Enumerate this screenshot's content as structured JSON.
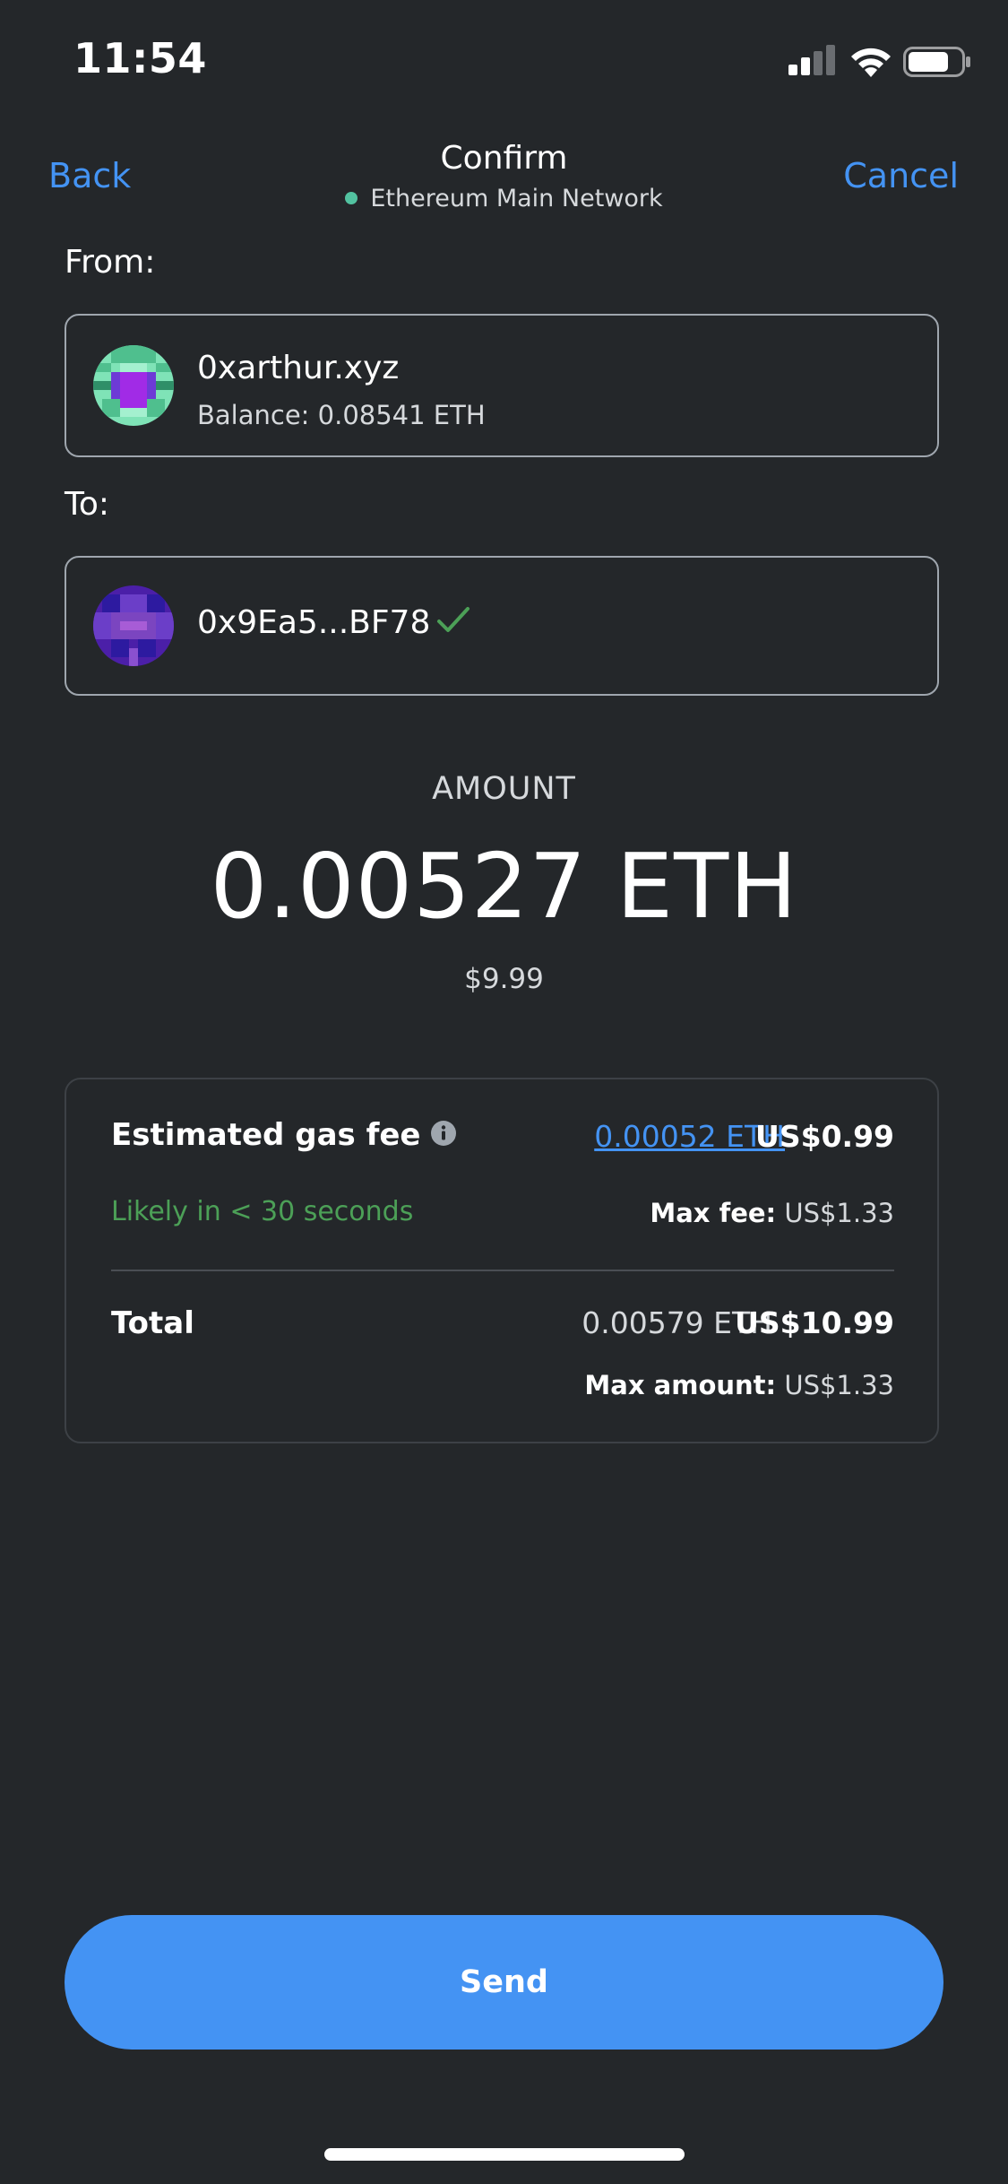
{
  "status_bar": {
    "time": "11:54",
    "icons": [
      "signal-icon",
      "wifi-icon",
      "battery-icon"
    ]
  },
  "header": {
    "back_label": "Back",
    "title": "Confirm",
    "network": "Ethereum Main Network",
    "cancel_label": "Cancel"
  },
  "from": {
    "label": "From:",
    "account_name": "0xarthur.xyz",
    "balance": "Balance: 0.08541 ETH"
  },
  "to": {
    "label": "To:",
    "address": "0x9Ea5...BF78",
    "verified_icon": "check-icon"
  },
  "amount": {
    "label": "AMOUNT",
    "value": "0.00527 ETH",
    "fiat": "$9.99"
  },
  "fee": {
    "label": "Estimated gas fee",
    "eth": "0.00052 ETH",
    "usd": "US$0.99",
    "time_estimate": "Likely in < 30 seconds",
    "max_fee_label": "Max fee:",
    "max_fee_value": "US$1.33"
  },
  "total": {
    "label": "Total",
    "eth": "0.00579 ETH",
    "usd": "US$10.99",
    "max_amount_label": "Max amount:",
    "max_amount_value": "US$1.33"
  },
  "send_label": "Send",
  "colors": {
    "background": "#24272a",
    "accent": "#4493f3",
    "network_dot": "#52c2a0",
    "success": "#4ca057"
  }
}
